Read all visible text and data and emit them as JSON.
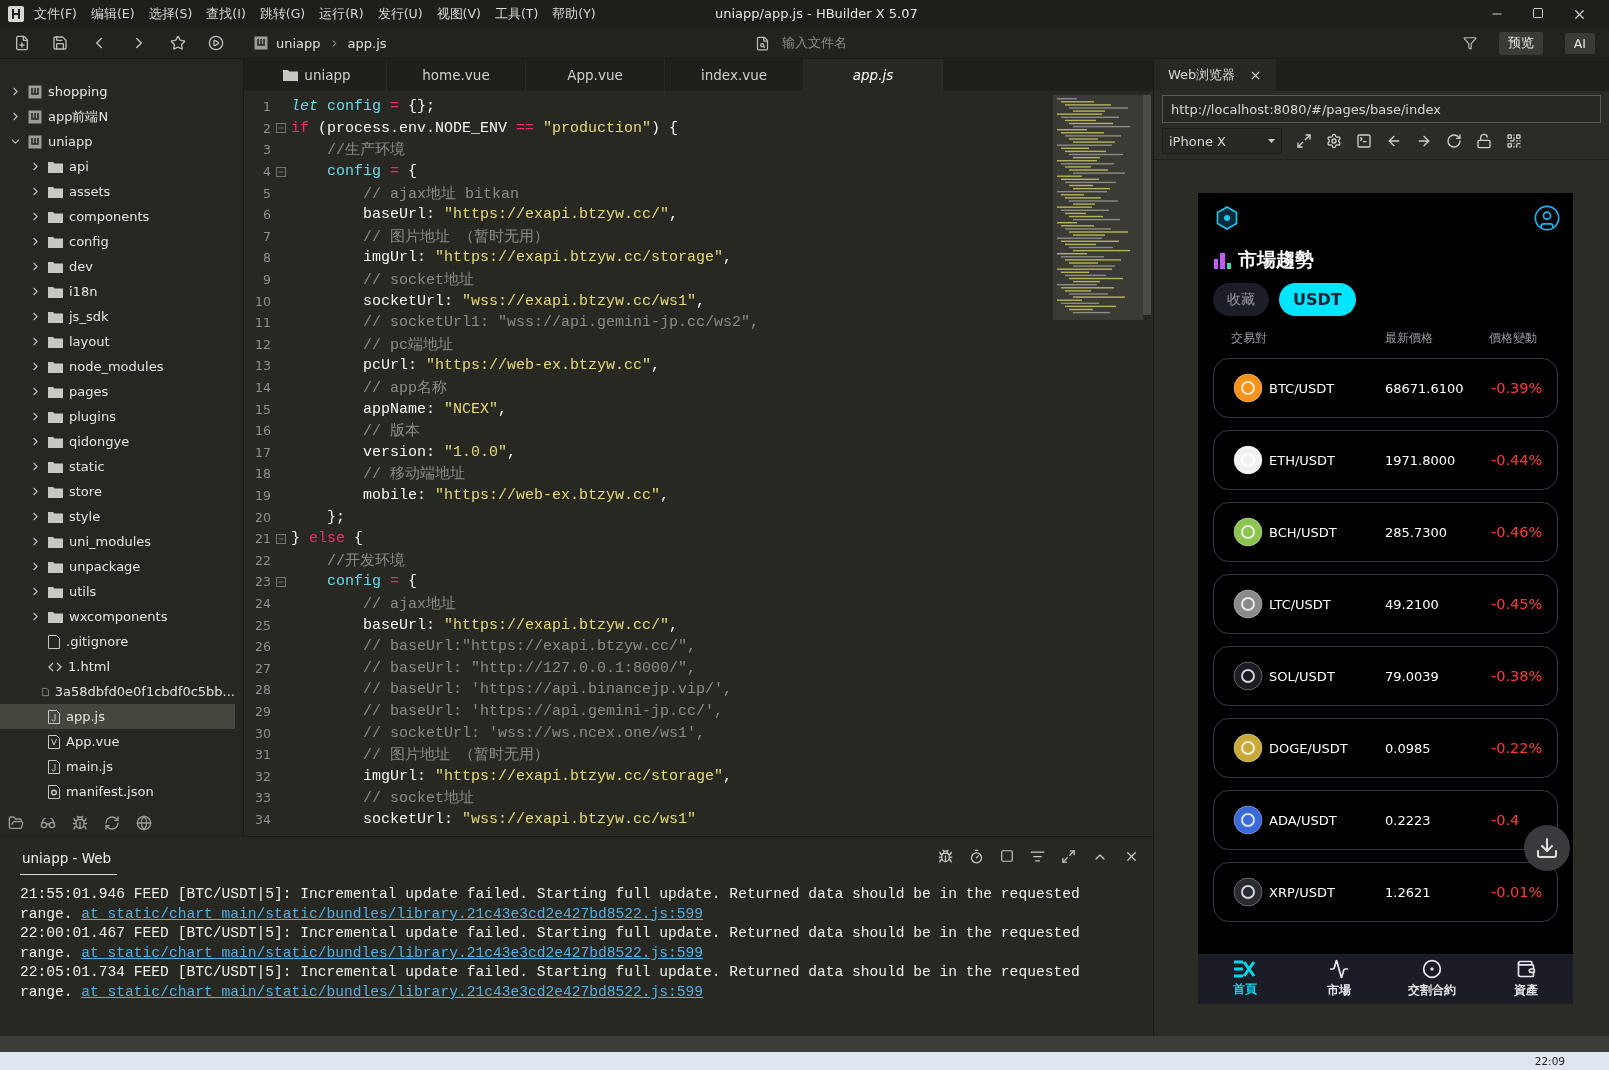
{
  "window": {
    "title": "uniapp/app.js - HBuilder X 5.07"
  },
  "menu": [
    "文件(F)",
    "编辑(E)",
    "选择(S)",
    "查找(I)",
    "跳转(G)",
    "运行(R)",
    "发行(U)",
    "视图(V)",
    "工具(T)",
    "帮助(Y)"
  ],
  "toolbar": {
    "breadcrumb": [
      "uniapp",
      "app.js"
    ],
    "file_search": {
      "placeholder": "输入文件名"
    },
    "buttons": [
      "预览",
      "AI"
    ]
  },
  "project_tree": [
    {
      "label": "shopping",
      "kind": "project",
      "expanded": false,
      "selected": false
    },
    {
      "label": "app前端N",
      "kind": "project",
      "expanded": false,
      "selected": false
    },
    {
      "label": "uniapp",
      "kind": "project",
      "expanded": true,
      "selected": false,
      "children": [
        {
          "label": "api",
          "kind": "folder",
          "expanded": false,
          "selected": false
        },
        {
          "label": "assets",
          "kind": "folder",
          "expanded": false,
          "selected": false
        },
        {
          "label": "components",
          "kind": "folder",
          "expanded": false,
          "selected": false
        },
        {
          "label": "config",
          "kind": "folder",
          "expanded": false,
          "selected": false
        },
        {
          "label": "dev",
          "kind": "folder",
          "expanded": false,
          "selected": false
        },
        {
          "label": "i18n",
          "kind": "folder",
          "expanded": false,
          "selected": false
        },
        {
          "label": "js_sdk",
          "kind": "folder",
          "expanded": false,
          "selected": false
        },
        {
          "label": "layout",
          "kind": "folder",
          "expanded": false,
          "selected": false
        },
        {
          "label": "node_modules",
          "kind": "folder",
          "expanded": false,
          "selected": false
        },
        {
          "label": "pages",
          "kind": "folder",
          "expanded": false,
          "selected": false
        },
        {
          "label": "plugins",
          "kind": "folder",
          "expanded": false,
          "selected": false
        },
        {
          "label": "qidongye",
          "kind": "folder",
          "expanded": false,
          "selected": false
        },
        {
          "label": "static",
          "kind": "folder",
          "expanded": false,
          "selected": false
        },
        {
          "label": "store",
          "kind": "folder",
          "expanded": false,
          "selected": false
        },
        {
          "label": "style",
          "kind": "folder",
          "expanded": false,
          "selected": false
        },
        {
          "label": "uni_modules",
          "kind": "folder",
          "expanded": false,
          "selected": false
        },
        {
          "label": "unpackage",
          "kind": "folder",
          "expanded": false,
          "selected": false
        },
        {
          "label": "utils",
          "kind": "folder",
          "expanded": false,
          "selected": false
        },
        {
          "label": "wxcomponents",
          "kind": "folder",
          "expanded": false,
          "selected": false
        },
        {
          "label": ".gitignore",
          "kind": "file",
          "selected": false
        },
        {
          "label": "1.html",
          "kind": "html",
          "selected": false
        },
        {
          "label": "3a58dbfd0e0f1cbdf0c5bb...",
          "kind": "file",
          "selected": false
        },
        {
          "label": "app.js",
          "kind": "js",
          "selected": true
        },
        {
          "label": "App.vue",
          "kind": "vue",
          "selected": false
        },
        {
          "label": "main.js",
          "kind": "js",
          "selected": false
        },
        {
          "label": "manifest.json",
          "kind": "json",
          "selected": false
        }
      ]
    }
  ],
  "editor": {
    "tabs": [
      {
        "label": "uniapp",
        "kind": "folder",
        "selected": false
      },
      {
        "label": "home.vue",
        "kind": "file",
        "selected": false
      },
      {
        "label": "App.vue",
        "kind": "file",
        "selected": false
      },
      {
        "label": "index.vue",
        "kind": "file",
        "selected": false
      },
      {
        "label": "app.js",
        "kind": "file",
        "selected": true
      }
    ],
    "lines": [
      {
        "number": "1",
        "fold": false,
        "tokens": [
          {
            "kind": "keyword_italic",
            "text": "let"
          },
          {
            "kind": "variable",
            "text": " config"
          },
          {
            "kind": "operator",
            "text": " ="
          },
          {
            "kind": "plain",
            "text": " {};"
          }
        ]
      },
      {
        "number": "2",
        "fold": true,
        "tokens": [
          {
            "kind": "keyword",
            "text": "if"
          },
          {
            "kind": "plain",
            "text": " (process.env.NODE_ENV"
          },
          {
            "kind": "operator",
            "text": " =="
          },
          {
            "kind": "string",
            "text": " \"production\""
          },
          {
            "kind": "plain",
            "text": ") {"
          }
        ]
      },
      {
        "number": "3",
        "fold": false,
        "tokens": [
          {
            "kind": "comment",
            "text": "    //生产环境"
          }
        ]
      },
      {
        "number": "4",
        "fold": true,
        "tokens": [
          {
            "kind": "variable",
            "text": "    config"
          },
          {
            "kind": "operator",
            "text": " ="
          },
          {
            "kind": "plain",
            "text": " {"
          }
        ]
      },
      {
        "number": "5",
        "fold": false,
        "tokens": [
          {
            "kind": "comment",
            "text": "        // ajax地址 bitkan"
          }
        ]
      },
      {
        "number": "6",
        "fold": false,
        "tokens": [
          {
            "kind": "plain",
            "text": "        baseUrl: "
          },
          {
            "kind": "string",
            "text": "\"https://exapi.btzyw.cc/\""
          },
          {
            "kind": "plain",
            "text": ","
          }
        ]
      },
      {
        "number": "7",
        "fold": false,
        "tokens": [
          {
            "kind": "comment",
            "text": "        // 图片地址 （暂时无用）"
          }
        ]
      },
      {
        "number": "8",
        "fold": false,
        "tokens": [
          {
            "kind": "plain",
            "text": "        imgUrl: "
          },
          {
            "kind": "string",
            "text": "\"https://exapi.btzyw.cc/storage\""
          },
          {
            "kind": "plain",
            "text": ","
          }
        ]
      },
      {
        "number": "9",
        "fold": false,
        "tokens": [
          {
            "kind": "comment",
            "text": "        // socket地址"
          }
        ]
      },
      {
        "number": "10",
        "fold": false,
        "tokens": [
          {
            "kind": "plain",
            "text": "        socketUrl: "
          },
          {
            "kind": "string",
            "text": "\"wss://exapi.btzyw.cc/ws1\""
          },
          {
            "kind": "plain",
            "text": ","
          }
        ]
      },
      {
        "number": "11",
        "fold": false,
        "tokens": [
          {
            "kind": "comment",
            "text": "        // socketUrl1: \"wss://api.gemini-jp.cc/ws2\","
          }
        ]
      },
      {
        "number": "12",
        "fold": false,
        "tokens": [
          {
            "kind": "comment",
            "text": "        // pc端地址"
          }
        ]
      },
      {
        "number": "13",
        "fold": false,
        "tokens": [
          {
            "kind": "plain",
            "text": "        pcUrl: "
          },
          {
            "kind": "string",
            "text": "\"https://web-ex.btzyw.cc\""
          },
          {
            "kind": "plain",
            "text": ","
          }
        ]
      },
      {
        "number": "14",
        "fold": false,
        "tokens": [
          {
            "kind": "comment",
            "text": "        // app名称"
          }
        ]
      },
      {
        "number": "15",
        "fold": false,
        "tokens": [
          {
            "kind": "plain",
            "text": "        appName: "
          },
          {
            "kind": "string",
            "text": "\"NCEX\""
          },
          {
            "kind": "plain",
            "text": ","
          }
        ]
      },
      {
        "number": "16",
        "fold": false,
        "tokens": [
          {
            "kind": "comment",
            "text": "        // 版本"
          }
        ]
      },
      {
        "number": "17",
        "fold": false,
        "tokens": [
          {
            "kind": "plain",
            "text": "        version: "
          },
          {
            "kind": "string",
            "text": "\"1.0.0\""
          },
          {
            "kind": "plain",
            "text": ","
          }
        ]
      },
      {
        "number": "18",
        "fold": false,
        "tokens": [
          {
            "kind": "comment",
            "text": "        // 移动端地址"
          }
        ]
      },
      {
        "number": "19",
        "fold": false,
        "tokens": [
          {
            "kind": "plain",
            "text": "        mobile: "
          },
          {
            "kind": "string",
            "text": "\"https://web-ex.btzyw.cc\""
          },
          {
            "kind": "plain",
            "text": ","
          }
        ]
      },
      {
        "number": "20",
        "fold": false,
        "tokens": [
          {
            "kind": "plain",
            "text": "    };"
          }
        ]
      },
      {
        "number": "21",
        "fold": true,
        "tokens": [
          {
            "kind": "plain",
            "text": "} "
          },
          {
            "kind": "keyword",
            "text": "else"
          },
          {
            "kind": "plain",
            "text": " {"
          }
        ]
      },
      {
        "number": "22",
        "fold": false,
        "tokens": [
          {
            "kind": "comment",
            "text": "    //开发环境"
          }
        ]
      },
      {
        "number": "23",
        "fold": true,
        "tokens": [
          {
            "kind": "variable",
            "text": "    config"
          },
          {
            "kind": "operator",
            "text": " ="
          },
          {
            "kind": "plain",
            "text": " {"
          }
        ]
      },
      {
        "number": "24",
        "fold": false,
        "tokens": [
          {
            "kind": "comment",
            "text": "        // ajax地址"
          }
        ]
      },
      {
        "number": "25",
        "fold": false,
        "tokens": [
          {
            "kind": "plain",
            "text": "        baseUrl: "
          },
          {
            "kind": "string",
            "text": "\"https://exapi.btzyw.cc/\""
          },
          {
            "kind": "plain",
            "text": ","
          }
        ]
      },
      {
        "number": "26",
        "fold": false,
        "tokens": [
          {
            "kind": "comment",
            "text": "        // baseUrl:\"https://exapi.btzyw.cc/\","
          }
        ]
      },
      {
        "number": "27",
        "fold": false,
        "tokens": [
          {
            "kind": "comment",
            "text": "        // baseUrl: \"http://127.0.0.1:8000/\","
          }
        ]
      },
      {
        "number": "28",
        "fold": false,
        "tokens": [
          {
            "kind": "comment",
            "text": "        // baseUrl: 'https://api.binancejp.vip/',"
          }
        ]
      },
      {
        "number": "29",
        "fold": false,
        "tokens": [
          {
            "kind": "comment",
            "text": "        // baseUrl: 'https://api.gemini-jp.cc/',"
          }
        ]
      },
      {
        "number": "30",
        "fold": false,
        "tokens": [
          {
            "kind": "comment",
            "text": "        // socketUrl: 'wss://ws.ncex.one/ws1',"
          }
        ]
      },
      {
        "number": "31",
        "fold": false,
        "tokens": [
          {
            "kind": "comment",
            "text": "        // 图片地址 （暂时无用）"
          }
        ]
      },
      {
        "number": "32",
        "fold": false,
        "tokens": [
          {
            "kind": "plain",
            "text": "        imgUrl: "
          },
          {
            "kind": "string",
            "text": "\"https://exapi.btzyw.cc/storage\""
          },
          {
            "kind": "plain",
            "text": ","
          }
        ]
      },
      {
        "number": "33",
        "fold": false,
        "tokens": [
          {
            "kind": "comment",
            "text": "        // socket地址"
          }
        ]
      },
      {
        "number": "34",
        "fold": false,
        "tokens": [
          {
            "kind": "plain",
            "text": "        socketUrl: "
          },
          {
            "kind": "string",
            "text": "\"wss://exapi.btzyw.cc/ws1\""
          }
        ]
      }
    ]
  },
  "console": {
    "tab": "uniapp - Web",
    "entries": [
      {
        "message": "21:55:01.946 FEED [BTC/USDT|5]: Incremental update failed. Starting full update. Returned data should be in the requested range.",
        "link": "at_static/chart_main/static/bundles/library.21c43e3cd2e427bd8522.js:599"
      },
      {
        "message": "22:00:01.467 FEED [BTC/USDT|5]: Incremental update failed. Starting full update. Returned data should be in the requested range.",
        "link": "at_static/chart_main/static/bundles/library.21c43e3cd2e427bd8522.js:599"
      },
      {
        "message": "22:05:01.734 FEED [BTC/USDT|5]: Incremental update failed. Starting full update. Returned data should be in the requested range.",
        "link": "at_static/chart_main/static/bundles/library.21c43e3cd2e427bd8522.js:599"
      }
    ]
  },
  "browser": {
    "tab": "Web浏览器",
    "url": "http://localhost:8080/#/pages/base/index",
    "device": "iPhone X",
    "app": {
      "title": "市場趨勢",
      "filters": [
        {
          "label": "收藏",
          "selected": false
        },
        {
          "label": "USDT",
          "selected": true
        }
      ],
      "columns": [
        "交易對",
        "最新價格",
        "價格變動"
      ],
      "rows": [
        {
          "pair": "BTC/USDT",
          "price": "68671.6100",
          "change": "-0.39%",
          "color": "#f7931a"
        },
        {
          "pair": "ETH/USDT",
          "price": "1971.8000",
          "change": "-0.44%",
          "color": "#f2f2f2"
        },
        {
          "pair": "BCH/USDT",
          "price": "285.7300",
          "change": "-0.46%",
          "color": "#8dc351"
        },
        {
          "pair": "LTC/USDT",
          "price": "49.2100",
          "change": "-0.45%",
          "color": "#8a8a8a"
        },
        {
          "pair": "SOL/USDT",
          "price": "79.0039",
          "change": "-0.38%",
          "color": "#1c1c24"
        },
        {
          "pair": "DOGE/USDT",
          "price": "0.0985",
          "change": "-0.22%",
          "color": "#c9a93a"
        },
        {
          "pair": "ADA/USDT",
          "price": "0.2223",
          "change": "-0.4",
          "color": "#3a6ad8"
        },
        {
          "pair": "XRP/USDT",
          "price": "1.2621",
          "change": "-0.01%",
          "color": "#2a2a32"
        }
      ],
      "nav": [
        {
          "label": "首頁",
          "kind": "home",
          "selected": true
        },
        {
          "label": "市場",
          "kind": "market",
          "selected": false
        },
        {
          "label": "交割合約",
          "kind": "contract",
          "selected": false
        },
        {
          "label": "資產",
          "kind": "assets",
          "selected": false
        }
      ]
    }
  },
  "taskbar": {
    "clock": "22:09"
  }
}
